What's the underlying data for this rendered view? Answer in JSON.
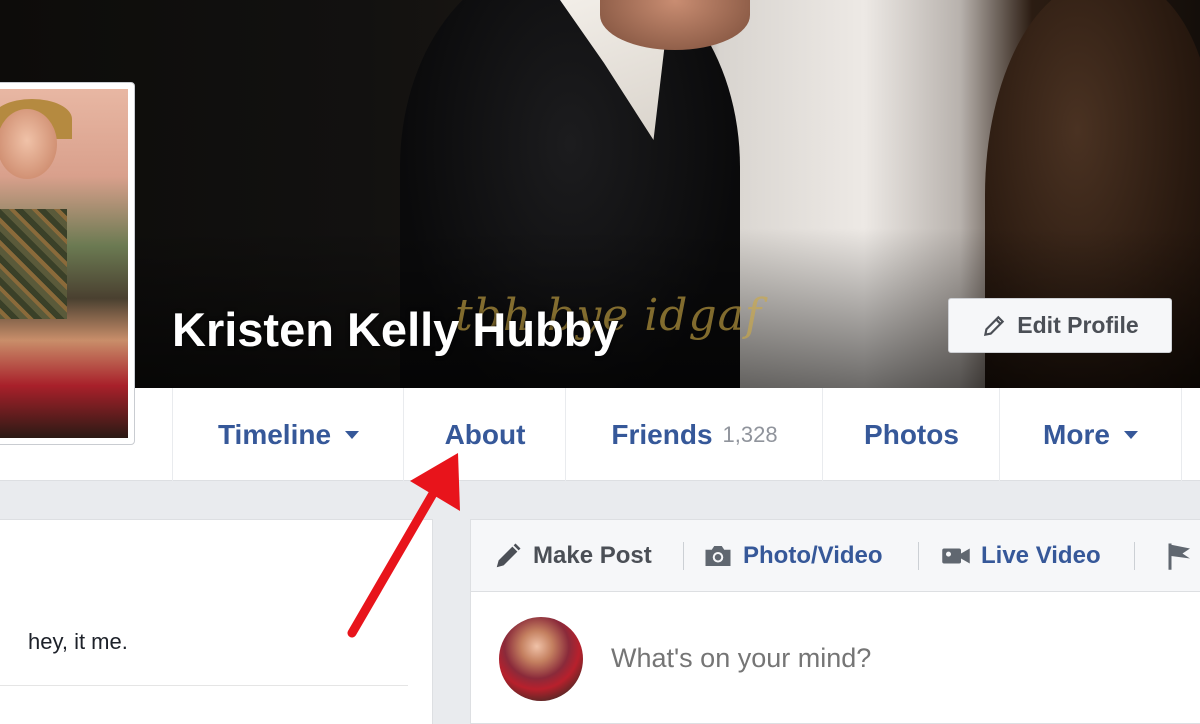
{
  "cover": {
    "watermark_text": "tbh bye idgaf",
    "profile_name": "Kristen Kelly Hubby",
    "edit_profile_label": "Edit Profile",
    "edit_profile_icon": "pencil-icon"
  },
  "nav": {
    "tabs": [
      {
        "label": "Timeline",
        "has_caret": true
      },
      {
        "label": "About"
      },
      {
        "label": "Friends",
        "count": "1,328"
      },
      {
        "label": "Photos"
      },
      {
        "label": "More",
        "has_caret": true
      }
    ]
  },
  "intro": {
    "bio": "hey, it me."
  },
  "composer": {
    "tabs": [
      {
        "label": "Make Post",
        "icon": "pencil-icon"
      },
      {
        "label": "Photo/Video",
        "icon": "camera-icon"
      },
      {
        "label": "Live Video",
        "icon": "video-camera-icon"
      },
      {
        "label": "",
        "icon": "flag-icon"
      }
    ],
    "placeholder": "What's on your mind?"
  },
  "colors": {
    "link_blue": "#365899",
    "annotation_arrow": "#e8141b"
  }
}
